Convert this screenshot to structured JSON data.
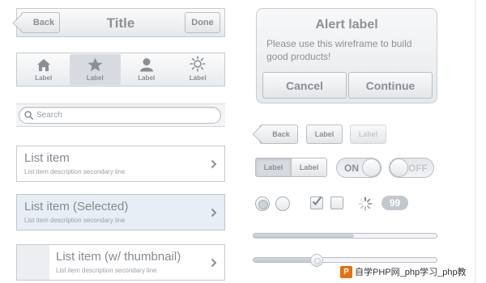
{
  "navbar": {
    "back_label": "Back",
    "title": "Title",
    "done_label": "Done"
  },
  "tabbar": {
    "items": [
      {
        "label": "Label",
        "icon": "home-icon",
        "selected": false
      },
      {
        "label": "Label",
        "icon": "star-icon",
        "selected": true
      },
      {
        "label": "Label",
        "icon": "user-icon",
        "selected": false
      },
      {
        "label": "Label",
        "icon": "sun-icon",
        "selected": false
      }
    ]
  },
  "search": {
    "placeholder": "Search"
  },
  "list": [
    {
      "title": "List item",
      "description": "List item description secondary line"
    },
    {
      "title": "List item (Selected)",
      "description": "List item description secondary line"
    },
    {
      "title": "List item (w/ thumbnail)",
      "description": "List item description secondary line"
    }
  ],
  "alert": {
    "title": "Alert label",
    "message": "Please use this wireframe to build good products!",
    "cancel_label": "Cancel",
    "continue_label": "Continue"
  },
  "controls": {
    "back_label": "Back",
    "label_button": "Label",
    "label_button_disabled": "Label",
    "segment": [
      "Label",
      "Label"
    ],
    "toggle_on": "ON",
    "toggle_off": "OFF",
    "badge": "99",
    "checkbox_checked": true,
    "checkbox_unchecked": false,
    "progress": 0.55,
    "slider": 0.35
  },
  "watermark": {
    "text": "自学PHP网_php学习_php教"
  },
  "colors": {
    "accent": "#8a8f96",
    "selected_row": "#e8eef5"
  }
}
